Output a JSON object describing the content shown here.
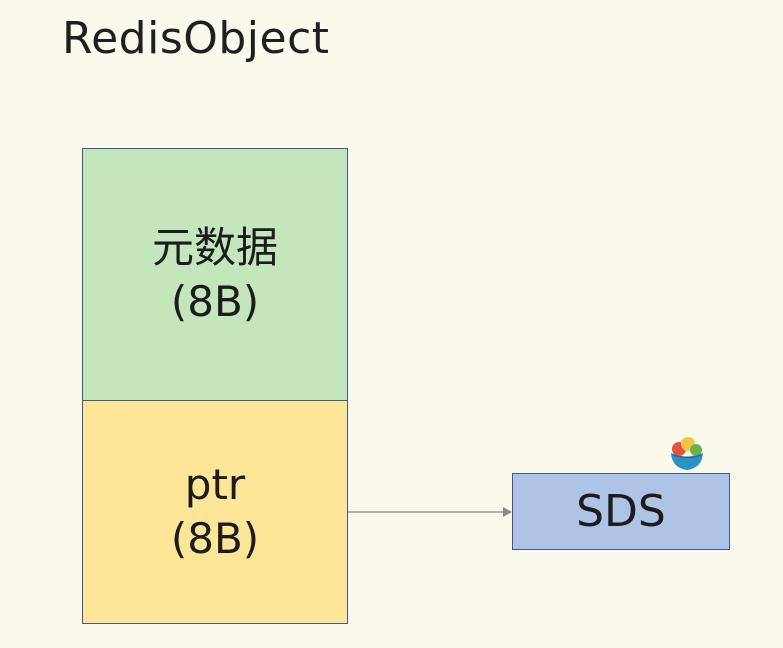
{
  "title": "RedisObject",
  "blocks": {
    "metadata": {
      "line1": "元数据",
      "line2": "(8B)"
    },
    "ptr": {
      "line1": "ptr",
      "line2": "(8B)"
    },
    "sds": {
      "label": "SDS"
    }
  },
  "colors": {
    "background": "#fbf8ec",
    "metadata_fill": "#c3e6bd",
    "ptr_fill": "#fde697",
    "sds_fill": "#aec4e7",
    "border": "#44578a",
    "arrow": "#8a8a8a"
  },
  "icons": {
    "watermark": "fruit-bowl-logo-icon"
  }
}
